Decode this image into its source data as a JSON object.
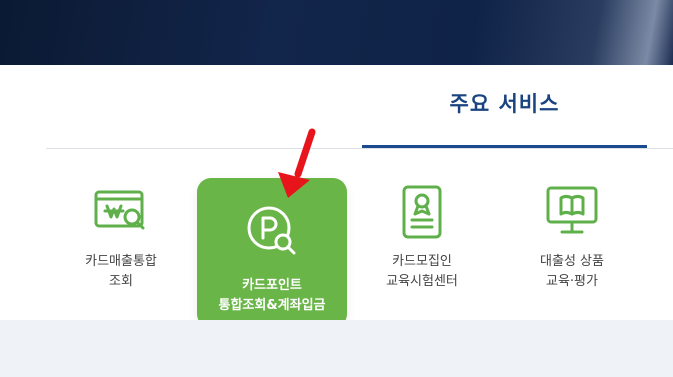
{
  "tabs": {
    "main_services_label": "주요 서비스"
  },
  "services": [
    {
      "label": "카드매출통합\n조회",
      "icon": "card-sales-search-icon",
      "active": false
    },
    {
      "label": "카드포인트\n통합조회&계좌입금",
      "icon": "point-search-icon",
      "active": true
    },
    {
      "label": "카드모집인\n교육시험센터",
      "icon": "certificate-document-icon",
      "active": false
    },
    {
      "label": "대출성 상품\n교육·평가",
      "icon": "monitor-book-icon",
      "active": false
    }
  ],
  "colors": {
    "accent_green": "#6ab548",
    "tab_active_blue": "#1a4b8f",
    "annotation_arrow_red": "#e8141b"
  }
}
